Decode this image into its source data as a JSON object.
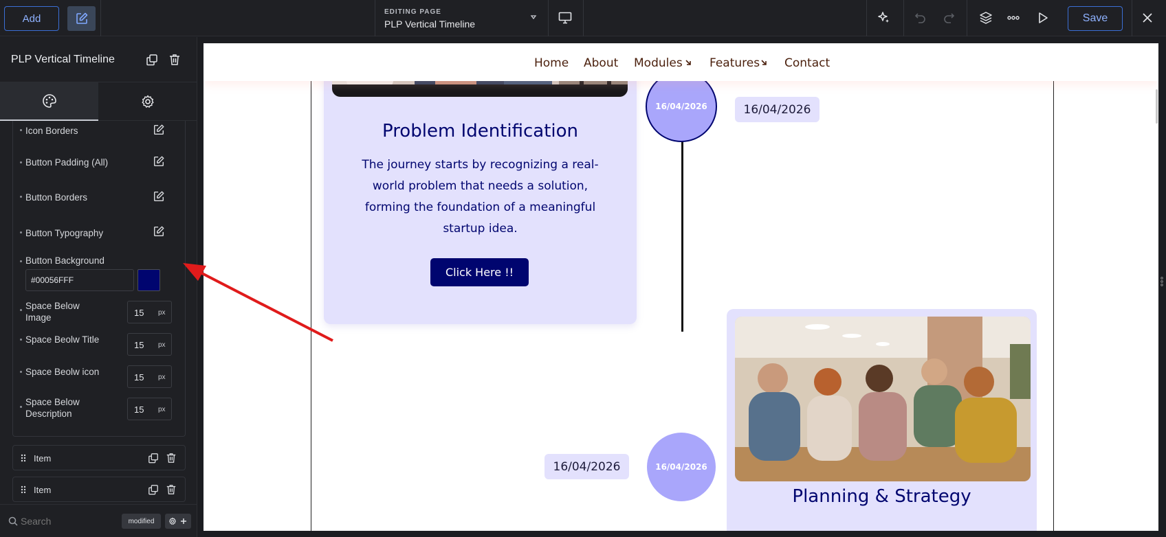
{
  "toolbar": {
    "add_label": "Add",
    "editing_label": "EDITING PAGE",
    "page_name": "PLP Vertical Timeline",
    "save_label": "Save"
  },
  "panel": {
    "title": "PLP Vertical Timeline",
    "fields": {
      "icon_borders": "Icon Borders",
      "button_padding": "Button Padding (All)",
      "button_borders": "Button Borders",
      "button_typography": "Button Typography",
      "button_background": "Button Background",
      "button_background_value": "#00056FFF",
      "space_below_image": "Space Below Image",
      "space_below_image_value": "15",
      "space_below_title": "Space Beolw Title",
      "space_below_title_value": "15",
      "space_below_icon": "Space Beolw icon",
      "space_below_icon_value": "15",
      "space_below_description": "Space Below Description",
      "space_below_description_value": "15",
      "unit": "px"
    },
    "items": [
      "Item",
      "Item"
    ],
    "search_placeholder": "Search",
    "modified_label": "modified"
  },
  "site": {
    "nav": [
      "Home",
      "About",
      "Modules",
      "Features",
      "Contact"
    ],
    "card1": {
      "title": "Problem Identification",
      "description": "The journey starts by recognizing a real-world problem that needs a solution, forming the foundation of a meaningful startup idea.",
      "button": "Click Here !!",
      "date_circle": "16/04/2026",
      "date_pill": "16/04/2026"
    },
    "card2": {
      "title": "Planning & Strategy",
      "date_circle": "16/04/2026",
      "date_pill": "16/04/2026"
    }
  },
  "colors": {
    "accent": "#00056F",
    "timeline_circle": "#A9A6FB",
    "card_bg": "#E3E1FD",
    "annotation_arrow": "#E01B1B"
  }
}
